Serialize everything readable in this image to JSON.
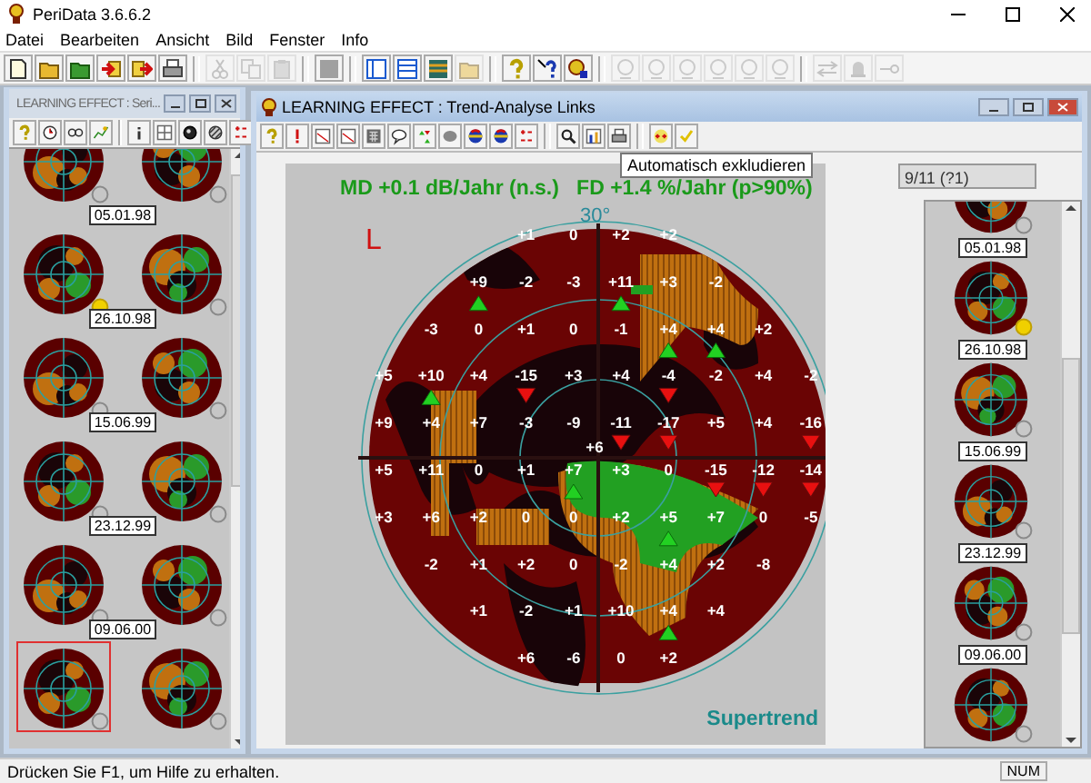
{
  "window": {
    "title": "PeriData 3.6.6.2"
  },
  "menu": [
    "Datei",
    "Bearbeiten",
    "Ansicht",
    "Bild",
    "Fenster",
    "Info"
  ],
  "toolbar": [
    {
      "kind": "document",
      "disabled": false
    },
    {
      "kind": "folder",
      "disabled": false
    },
    {
      "kind": "folder-green",
      "disabled": false
    },
    {
      "kind": "import",
      "disabled": false
    },
    {
      "kind": "export",
      "disabled": false
    },
    {
      "kind": "printer",
      "disabled": false
    },
    {
      "kind": "separator"
    },
    {
      "kind": "scissors",
      "disabled": true
    },
    {
      "kind": "copy",
      "disabled": true
    },
    {
      "kind": "paste",
      "disabled": true
    },
    {
      "kind": "separator"
    },
    {
      "kind": "square",
      "disabled": false
    },
    {
      "kind": "separator"
    },
    {
      "kind": "panes-v",
      "disabled": false
    },
    {
      "kind": "panes-h",
      "disabled": false
    },
    {
      "kind": "panes-stack",
      "disabled": false
    },
    {
      "kind": "folder",
      "disabled": true
    },
    {
      "kind": "separator"
    },
    {
      "kind": "help",
      "disabled": false
    },
    {
      "kind": "context-help",
      "disabled": false
    },
    {
      "kind": "badge",
      "disabled": false
    },
    {
      "kind": "separator"
    },
    {
      "kind": "gauge",
      "disabled": true
    },
    {
      "kind": "gauge",
      "disabled": true
    },
    {
      "kind": "gauge",
      "disabled": true
    },
    {
      "kind": "gauge",
      "disabled": true
    },
    {
      "kind": "gauge",
      "disabled": true
    },
    {
      "kind": "gauge",
      "disabled": true
    },
    {
      "kind": "separator"
    },
    {
      "kind": "swap",
      "disabled": true
    },
    {
      "kind": "bell",
      "disabled": true
    },
    {
      "kind": "pin",
      "disabled": true
    }
  ],
  "series_window": {
    "title": "LEARNING EFFECT :  Seri...",
    "active": false,
    "toolbar": [
      {
        "kind": "help"
      },
      {
        "kind": "clock"
      },
      {
        "kind": "glasses"
      },
      {
        "kind": "chart-star"
      },
      {
        "kind": "separator"
      },
      {
        "kind": "info"
      },
      {
        "kind": "grid"
      },
      {
        "kind": "circle-dark"
      },
      {
        "kind": "circle-hatched"
      },
      {
        "kind": "plus-minus"
      }
    ],
    "rows": [
      {
        "maps": [
          {
            "flagged": false,
            "selected": false
          },
          {
            "flagged": false,
            "selected": false
          }
        ]
      },
      {
        "date": "05.01.98",
        "maps": [
          {
            "flagged": true,
            "selected": false
          },
          {
            "flagged": false,
            "selected": false
          }
        ]
      },
      {
        "date": "26.10.98",
        "maps": [
          {
            "flagged": false,
            "selected": false
          },
          {
            "flagged": false,
            "selected": false
          }
        ]
      },
      {
        "date": "15.06.99",
        "maps": [
          {
            "flagged": false,
            "selected": false
          },
          {
            "flagged": false,
            "selected": false
          }
        ]
      },
      {
        "date": "23.12.99",
        "maps": [
          {
            "flagged": false,
            "selected": false
          },
          {
            "flagged": false,
            "selected": false
          }
        ]
      },
      {
        "date": "09.06.00",
        "maps": [
          {
            "flagged": false,
            "selected": true
          },
          {
            "flagged": false,
            "selected": false
          }
        ]
      }
    ]
  },
  "trend_window": {
    "title": "LEARNING EFFECT :  Trend-Analyse Links",
    "active": true,
    "toolbar": [
      {
        "kind": "help"
      },
      {
        "kind": "exclamation"
      },
      {
        "kind": "chart"
      },
      {
        "kind": "chart"
      },
      {
        "kind": "calculator"
      },
      {
        "kind": "bubble"
      },
      {
        "kind": "triangles"
      },
      {
        "kind": "blob"
      },
      {
        "kind": "ball"
      },
      {
        "kind": "ball"
      },
      {
        "kind": "plus-minus"
      },
      {
        "kind": "separator"
      },
      {
        "kind": "magnifier"
      },
      {
        "kind": "figure"
      },
      {
        "kind": "printer"
      },
      {
        "kind": "separator"
      },
      {
        "kind": "plus-plus"
      },
      {
        "kind": "check"
      }
    ],
    "tooltip": "Automatisch exkludieren",
    "summary": "MD +0.1 dB/Jahr (n.s.)   FD +1.4 %/Jahr (p>90%)",
    "eye": "L",
    "scale_label": "30°",
    "label": "Supertrend",
    "center": {
      "value": "+6"
    },
    "grid": [
      {
        "cells": [
          {
            "value": "+1",
            "rising": false,
            "falling": false
          },
          {
            "value": "0",
            "rising": false,
            "falling": false
          },
          {
            "value": "+2",
            "rising": false,
            "falling": false
          },
          {
            "value": "+2",
            "rising": false,
            "falling": false
          }
        ]
      },
      {
        "cells": [
          {
            "value": "+9",
            "rising": true,
            "falling": false
          },
          {
            "value": "-2",
            "rising": false,
            "falling": false
          },
          {
            "value": "-3",
            "rising": false,
            "falling": false
          },
          {
            "value": "+11",
            "rising": true,
            "falling": false
          },
          {
            "value": "+3",
            "rising": false,
            "falling": false
          },
          {
            "value": "-2",
            "rising": false,
            "falling": false
          }
        ]
      },
      {
        "cells": [
          {
            "value": "-3",
            "rising": false,
            "falling": false
          },
          {
            "value": "0",
            "rising": false,
            "falling": false
          },
          {
            "value": "+1",
            "rising": false,
            "falling": false
          },
          {
            "value": "0",
            "rising": false,
            "falling": false
          },
          {
            "value": "-1",
            "rising": false,
            "falling": false
          },
          {
            "value": "+4",
            "rising": true,
            "falling": false
          },
          {
            "value": "+4",
            "rising": true,
            "falling": false
          },
          {
            "value": "+2",
            "rising": false,
            "falling": false
          }
        ]
      },
      {
        "cells": [
          {
            "value": "+5",
            "rising": false,
            "falling": false
          },
          {
            "value": "+10",
            "rising": true,
            "falling": false
          },
          {
            "value": "+4",
            "rising": false,
            "falling": false
          },
          {
            "value": "-15",
            "rising": false,
            "falling": true
          },
          {
            "value": "+3",
            "rising": false,
            "falling": false
          },
          {
            "value": "+4",
            "rising": false,
            "falling": false
          },
          {
            "value": "-4",
            "rising": false,
            "falling": true
          },
          {
            "value": "-2",
            "rising": false,
            "falling": false
          },
          {
            "value": "+4",
            "rising": false,
            "falling": false
          },
          {
            "value": "-2",
            "rising": false,
            "falling": false
          }
        ]
      },
      {
        "cells": [
          {
            "value": "+9",
            "rising": false,
            "falling": false
          },
          {
            "value": "+4",
            "rising": false,
            "falling": false
          },
          {
            "value": "+7",
            "rising": false,
            "falling": false
          },
          {
            "value": "-3",
            "rising": false,
            "falling": false
          },
          {
            "value": "-9",
            "rising": false,
            "falling": false
          },
          {
            "value": "-11",
            "rising": false,
            "falling": true
          },
          {
            "value": "-17",
            "rising": false,
            "falling": true
          },
          {
            "value": "+5",
            "rising": false,
            "falling": false
          },
          {
            "value": "+4",
            "rising": false,
            "falling": false
          },
          {
            "value": "-16",
            "rising": false,
            "falling": true
          }
        ]
      },
      {
        "cells": [
          {
            "value": "+5",
            "rising": false,
            "falling": false
          },
          {
            "value": "+11",
            "rising": false,
            "falling": false
          },
          {
            "value": "0",
            "rising": false,
            "falling": false
          },
          {
            "value": "+1",
            "rising": false,
            "falling": false
          },
          {
            "value": "+7",
            "rising": true,
            "falling": false
          },
          {
            "value": "+3",
            "rising": false,
            "falling": false
          },
          {
            "value": "0",
            "rising": false,
            "falling": false
          },
          {
            "value": "-15",
            "rising": false,
            "falling": true
          },
          {
            "value": "-12",
            "rising": false,
            "falling": true
          },
          {
            "value": "-14",
            "rising": false,
            "falling": true
          }
        ]
      },
      {
        "cells": [
          {
            "value": "+3",
            "rising": false,
            "falling": false
          },
          {
            "value": "+6",
            "rising": false,
            "falling": false
          },
          {
            "value": "+2",
            "rising": false,
            "falling": false
          },
          {
            "value": "0",
            "rising": false,
            "falling": false
          },
          {
            "value": "0",
            "rising": false,
            "falling": false
          },
          {
            "value": "+2",
            "rising": false,
            "falling": false
          },
          {
            "value": "+5",
            "rising": true,
            "falling": false
          },
          {
            "value": "+7",
            "rising": false,
            "falling": false
          },
          {
            "value": "0",
            "rising": false,
            "falling": false
          },
          {
            "value": "-5",
            "rising": false,
            "falling": false
          }
        ]
      },
      {
        "cells": [
          {
            "value": "-2",
            "rising": false,
            "falling": false
          },
          {
            "value": "+1",
            "rising": false,
            "falling": false
          },
          {
            "value": "+2",
            "rising": false,
            "falling": false
          },
          {
            "value": "0",
            "rising": false,
            "falling": false
          },
          {
            "value": "-2",
            "rising": false,
            "falling": false
          },
          {
            "value": "+4",
            "rising": false,
            "falling": false
          },
          {
            "value": "+2",
            "rising": false,
            "falling": false
          },
          {
            "value": "-8",
            "rising": false,
            "falling": false
          }
        ]
      },
      {
        "cells": [
          {
            "value": "+1",
            "rising": false,
            "falling": false
          },
          {
            "value": "-2",
            "rising": false,
            "falling": false
          },
          {
            "value": "+1",
            "rising": false,
            "falling": false
          },
          {
            "value": "+10",
            "rising": false,
            "falling": false
          },
          {
            "value": "+4",
            "rising": true,
            "falling": false
          },
          {
            "value": "+4",
            "rising": false,
            "falling": false
          }
        ]
      },
      {
        "cells": [
          {
            "value": "+6",
            "rising": false,
            "falling": false
          },
          {
            "value": "-6",
            "rising": false,
            "falling": false
          },
          {
            "value": "0",
            "rising": false,
            "falling": false
          },
          {
            "value": "+2",
            "rising": false,
            "falling": false
          }
        ]
      }
    ],
    "counter": "9/11 (?1)",
    "thumbnails": [
      {
        "flagged": false
      },
      {
        "date": "05.01.98",
        "flagged": true
      },
      {
        "date": "26.10.98",
        "flagged": false
      },
      {
        "date": "15.06.99",
        "flagged": false
      },
      {
        "date": "23.12.99",
        "flagged": false
      },
      {
        "date": "09.06.00",
        "flagged": false
      }
    ]
  },
  "status_bar": {
    "message": "Drücken Sie F1, um Hilfe zu erhalten.",
    "indicator": "NUM"
  }
}
